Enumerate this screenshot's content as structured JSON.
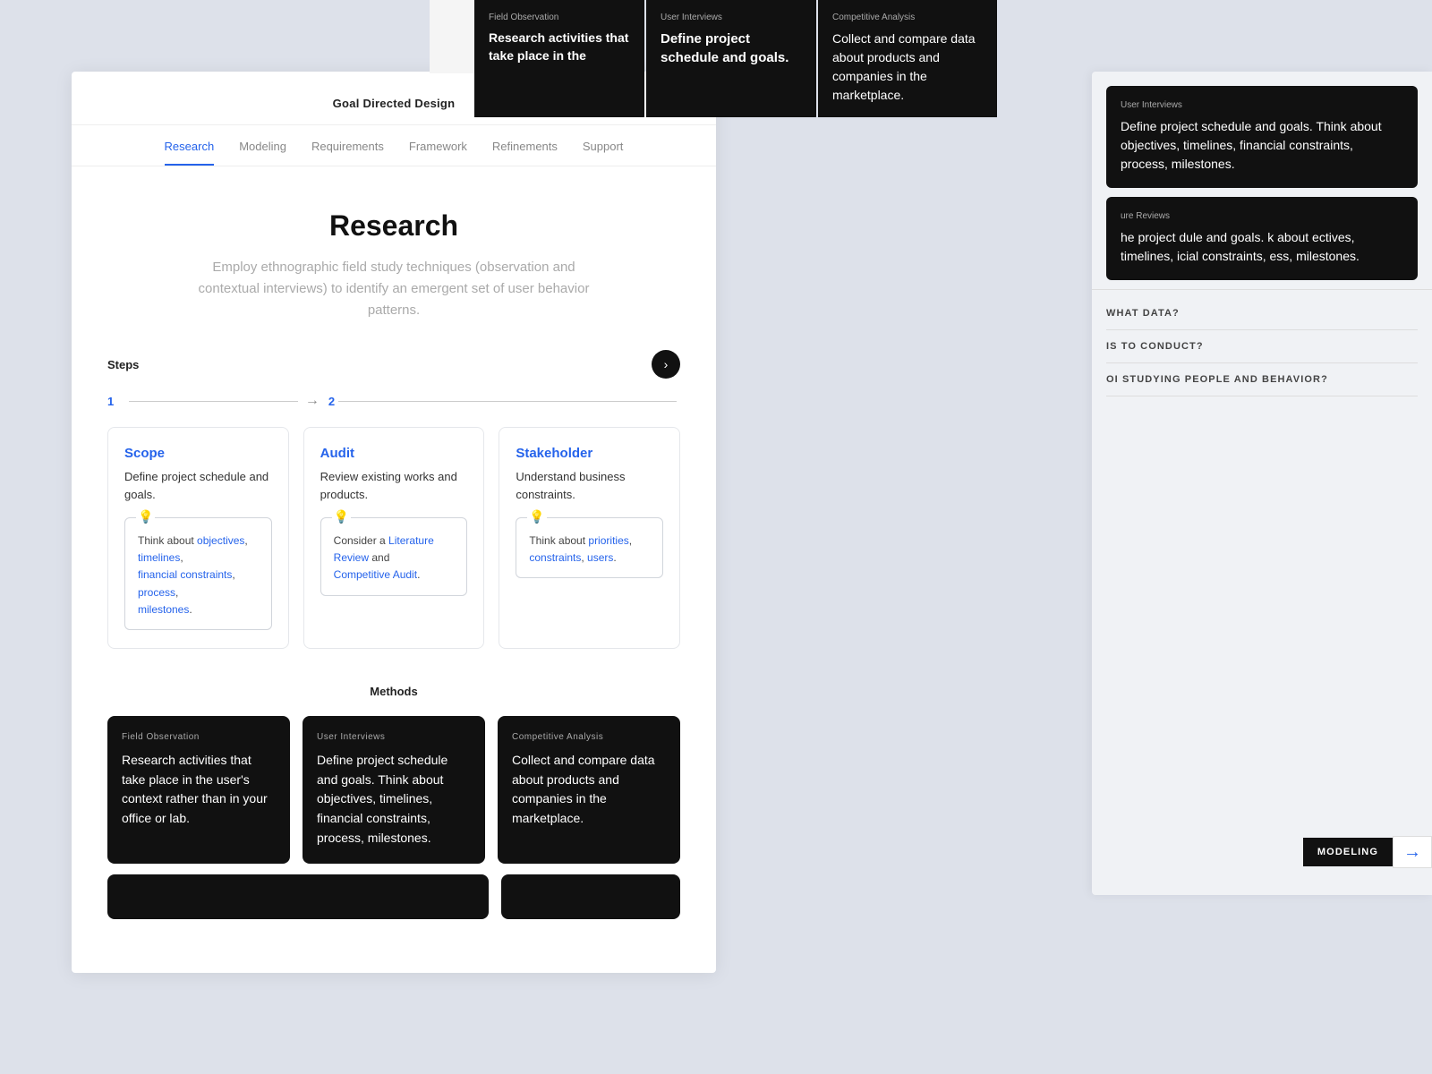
{
  "app": {
    "header_title": "Goal Directed Design"
  },
  "nav": {
    "tabs": [
      {
        "id": "research",
        "label": "Research",
        "active": true
      },
      {
        "id": "modeling",
        "label": "Modeling",
        "active": false
      },
      {
        "id": "requirements",
        "label": "Requirements",
        "active": false
      },
      {
        "id": "framework",
        "label": "Framework",
        "active": false
      },
      {
        "id": "refinements",
        "label": "Refinements",
        "active": false
      },
      {
        "id": "support",
        "label": "Support",
        "active": false
      }
    ]
  },
  "hero": {
    "title": "Research",
    "description": "Employ ethnographic field study techniques (observation and contextual interviews) to identify an emergent set of user behavior patterns."
  },
  "steps": {
    "label": "Steps",
    "step1": "1",
    "step2": "2",
    "nav_button_label": "›",
    "cards": [
      {
        "id": "scope",
        "title": "Scope",
        "description": "Define project schedule and goals.",
        "tip": "Think about",
        "tip_links": [
          "objectives",
          "timelines",
          "financial constraints",
          "process",
          "milestones"
        ]
      },
      {
        "id": "audit",
        "title": "Audit",
        "description": "Review existing works and products.",
        "tip": "Consider a",
        "tip_links": [
          "Literature Review",
          "Competitive Audit"
        ]
      },
      {
        "id": "stakeholder",
        "title": "Stakeholder",
        "description": "Understand business constraints.",
        "tip": "Think about",
        "tip_links": [
          "priorities",
          "constraints",
          "users"
        ]
      }
    ]
  },
  "methods": {
    "label": "Methods",
    "cards": [
      {
        "id": "field-observation",
        "tag": "Field Observation",
        "description": "Research activities that take place in the user's context rather than in your office or lab."
      },
      {
        "id": "user-interviews",
        "tag": "User Interviews",
        "description": "Define project schedule and goals. Think about objectives, timelines, financial constraints, process, milestones."
      },
      {
        "id": "competitive-analysis",
        "tag": "Competitive Analysis",
        "description": "Collect and compare data about products and companies in the marketplace."
      }
    ]
  },
  "popup_cards_top": [
    {
      "tag": "Field Observation",
      "text": "Research activities that take place in the"
    },
    {
      "tag": "User Interviews",
      "text": "Define project schedule and goals."
    },
    {
      "tag": "Competitive Analysis",
      "text": "Collect and compare data about products and companies in the marketplace."
    }
  ],
  "right_cards": [
    {
      "tag": "User Interviews",
      "text": "Define project schedule and goals. Think about objectives, timelines, financial constraints, process, milestones."
    },
    {
      "tag": "ure Reviews",
      "text": "he project dule and goals. k about ectives, timelines, icial constraints, ess, milestones."
    }
  ],
  "right_questions": [
    "WHAT DATA?",
    "IS TO CONDUCT?",
    "OI STUDYING PEOPLE AND BEHAVIOR?"
  ],
  "modeling_button": {
    "label": "MODELING",
    "arrow": "→"
  },
  "icons": {
    "lightbulb": "💡",
    "chevron_right": "›"
  }
}
